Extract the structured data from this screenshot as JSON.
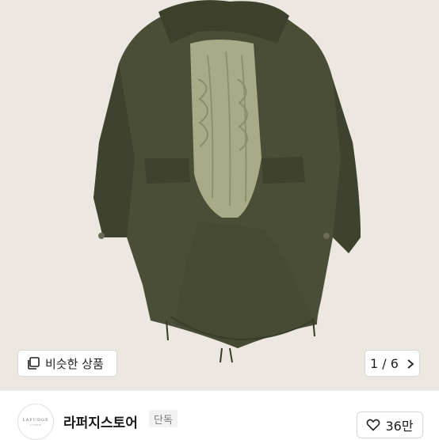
{
  "gallery": {
    "image_alt": "olive military fishtail parka with quilted liner",
    "similar_button_label": "비슷한 상품",
    "similar_icon": "copy-icon",
    "counter_text": "1 / 6",
    "counter_icon": "chevron-right-icon"
  },
  "store": {
    "logo_text": "LAFUDGE",
    "logo_subtext": "STORE",
    "name": "라퍼지스토어",
    "badge": "단독"
  },
  "like": {
    "icon": "heart-outline-icon",
    "count": "36만"
  },
  "colors": {
    "coat": "#4a4e36",
    "liner": "#a9ab88",
    "background": "#ece8e1"
  }
}
